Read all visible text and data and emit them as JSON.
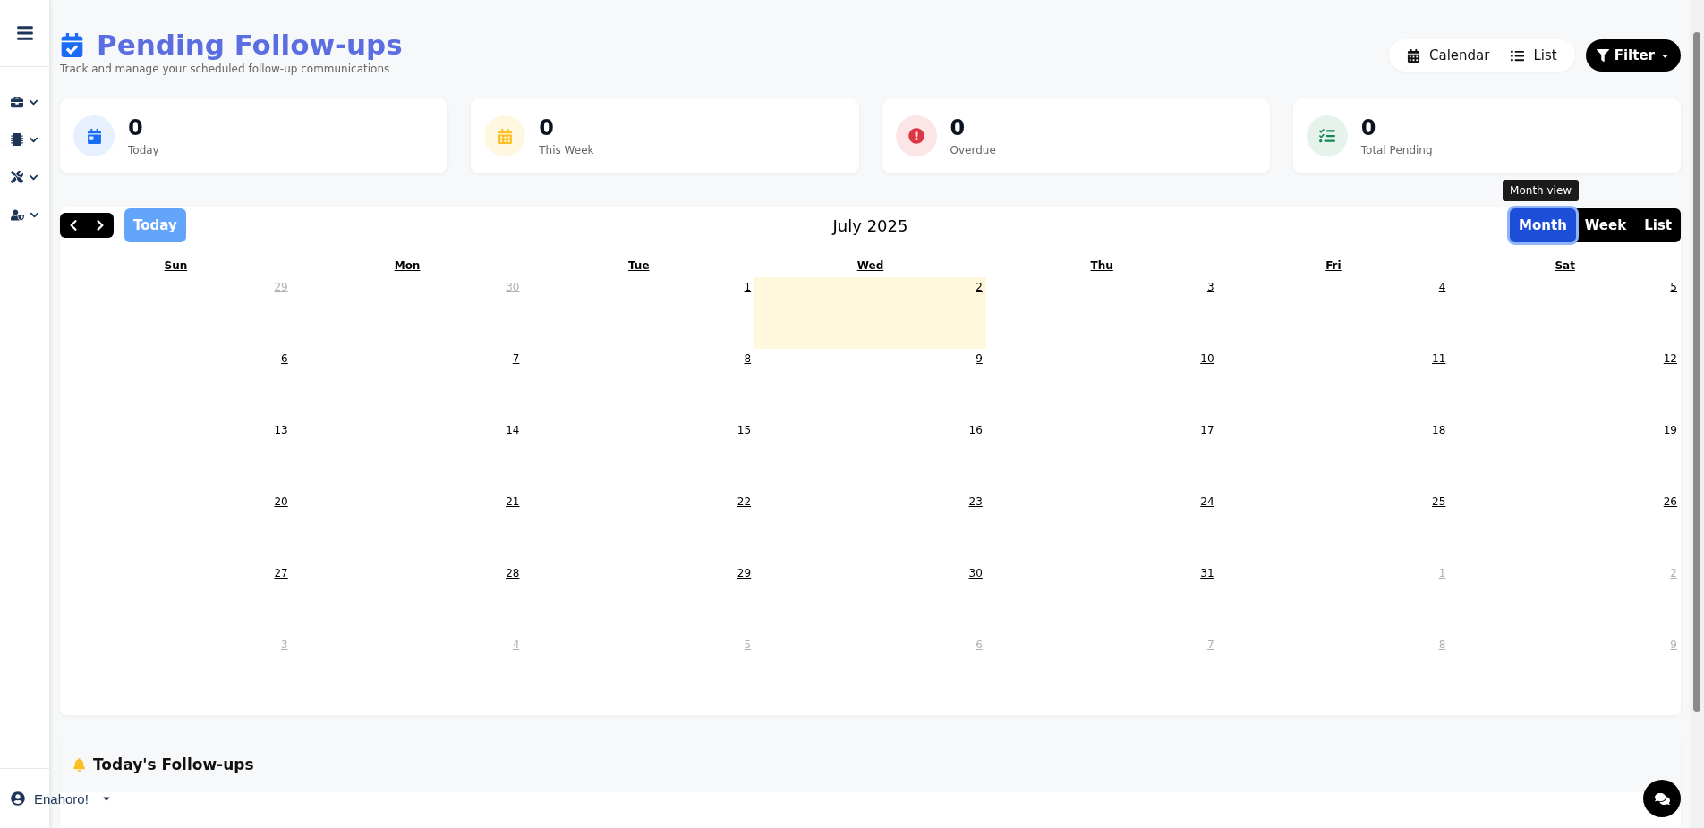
{
  "sidebar": {
    "items": [
      {
        "kind": "briefcase"
      },
      {
        "kind": "chip"
      },
      {
        "kind": "tools"
      },
      {
        "kind": "user-shield"
      }
    ],
    "user": {
      "name": "Enahoro!"
    }
  },
  "header": {
    "title": "Pending Follow-ups",
    "subtitle": "Track and manage your scheduled follow-up communications",
    "views": [
      {
        "label": "Calendar",
        "kind": "calendar"
      },
      {
        "label": "List",
        "kind": "list"
      }
    ],
    "filter": "Filter"
  },
  "stats": [
    {
      "kind": "today",
      "value": "0",
      "label": "Today"
    },
    {
      "kind": "week",
      "value": "0",
      "label": "This Week"
    },
    {
      "kind": "overdue",
      "value": "0",
      "label": "Overdue"
    },
    {
      "kind": "total",
      "value": "0",
      "label": "Total Pending"
    }
  ],
  "calendar": {
    "title": "July 2025",
    "today_button": "Today",
    "tooltip": "Month view",
    "views": [
      {
        "label": "Month",
        "selected": true
      },
      {
        "label": "Week",
        "selected": false
      },
      {
        "label": "List",
        "selected": false
      }
    ],
    "weekdays": [
      "Sun",
      "Mon",
      "Tue",
      "Wed",
      "Thu",
      "Fri",
      "Sat"
    ],
    "weeks": [
      [
        {
          "day": "29",
          "outside": true,
          "today": false
        },
        {
          "day": "30",
          "outside": true,
          "today": false
        },
        {
          "day": "1",
          "outside": false,
          "today": false
        },
        {
          "day": "2",
          "outside": false,
          "today": true
        },
        {
          "day": "3",
          "outside": false,
          "today": false
        },
        {
          "day": "4",
          "outside": false,
          "today": false
        },
        {
          "day": "5",
          "outside": false,
          "today": false
        }
      ],
      [
        {
          "day": "6",
          "outside": false,
          "today": false
        },
        {
          "day": "7",
          "outside": false,
          "today": false
        },
        {
          "day": "8",
          "outside": false,
          "today": false
        },
        {
          "day": "9",
          "outside": false,
          "today": false
        },
        {
          "day": "10",
          "outside": false,
          "today": false
        },
        {
          "day": "11",
          "outside": false,
          "today": false
        },
        {
          "day": "12",
          "outside": false,
          "today": false
        }
      ],
      [
        {
          "day": "13",
          "outside": false,
          "today": false
        },
        {
          "day": "14",
          "outside": false,
          "today": false
        },
        {
          "day": "15",
          "outside": false,
          "today": false
        },
        {
          "day": "16",
          "outside": false,
          "today": false
        },
        {
          "day": "17",
          "outside": false,
          "today": false
        },
        {
          "day": "18",
          "outside": false,
          "today": false
        },
        {
          "day": "19",
          "outside": false,
          "today": false
        }
      ],
      [
        {
          "day": "20",
          "outside": false,
          "today": false
        },
        {
          "day": "21",
          "outside": false,
          "today": false
        },
        {
          "day": "22",
          "outside": false,
          "today": false
        },
        {
          "day": "23",
          "outside": false,
          "today": false
        },
        {
          "day": "24",
          "outside": false,
          "today": false
        },
        {
          "day": "25",
          "outside": false,
          "today": false
        },
        {
          "day": "26",
          "outside": false,
          "today": false
        }
      ],
      [
        {
          "day": "27",
          "outside": false,
          "today": false
        },
        {
          "day": "28",
          "outside": false,
          "today": false
        },
        {
          "day": "29",
          "outside": false,
          "today": false
        },
        {
          "day": "30",
          "outside": false,
          "today": false
        },
        {
          "day": "31",
          "outside": false,
          "today": false
        },
        {
          "day": "1",
          "outside": true,
          "today": false
        },
        {
          "day": "2",
          "outside": true,
          "today": false
        }
      ],
      [
        {
          "day": "3",
          "outside": true,
          "today": false
        },
        {
          "day": "4",
          "outside": true,
          "today": false
        },
        {
          "day": "5",
          "outside": true,
          "today": false
        },
        {
          "day": "6",
          "outside": true,
          "today": false
        },
        {
          "day": "7",
          "outside": true,
          "today": false
        },
        {
          "day": "8",
          "outside": true,
          "today": false
        },
        {
          "day": "9",
          "outside": true,
          "today": false
        }
      ]
    ]
  },
  "todays_section": {
    "title": "Today's Follow-ups"
  }
}
